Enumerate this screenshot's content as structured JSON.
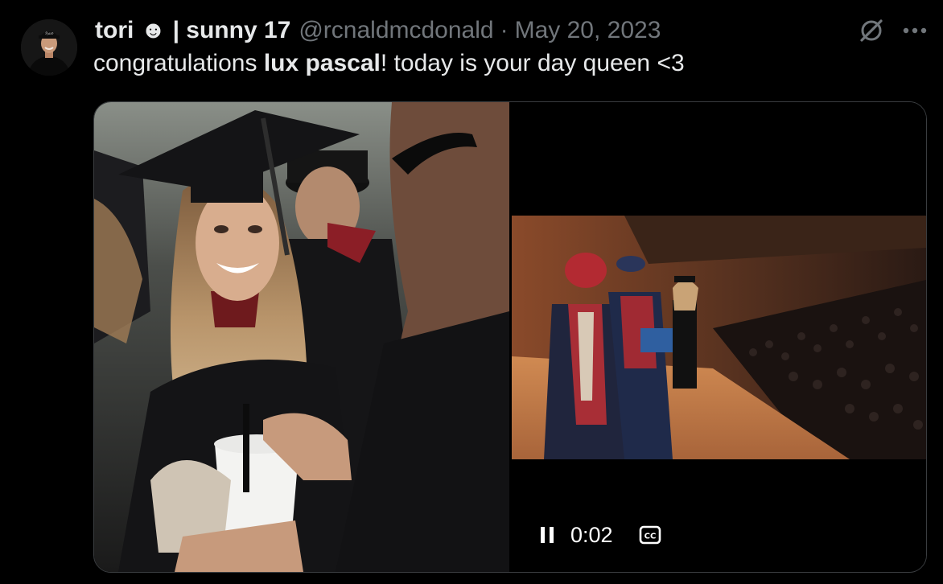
{
  "tweet": {
    "display_name": "tori ☻ | sunny 17",
    "handle": "@rcnaldmcdonald",
    "separator": "·",
    "date": "May 20, 2023",
    "text_before": "congratulations ",
    "text_bold": "lux pascal",
    "text_after": "! today is your day queen <3"
  },
  "video": {
    "time": "0:02",
    "state": "playing",
    "captions_label": "CC"
  },
  "icons": {
    "grok": "grok-icon",
    "more": "more-icon",
    "pause": "pause-icon",
    "captions": "captions-icon"
  },
  "colors": {
    "background": "#000000",
    "text_primary": "#e7e9ea",
    "text_secondary": "#71767b",
    "card_border": "#3a3d40"
  }
}
